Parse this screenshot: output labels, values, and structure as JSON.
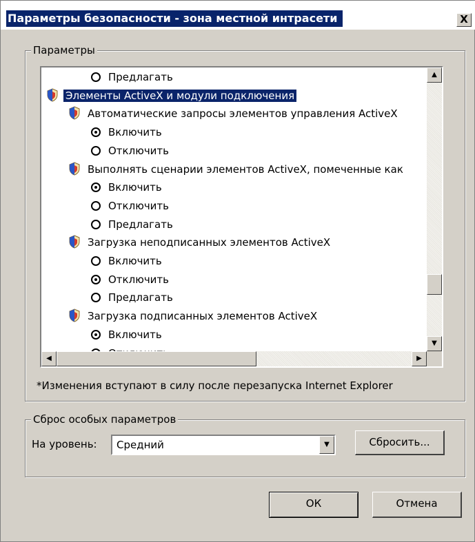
{
  "window": {
    "title": "Параметры безопасности - зона местной интрасети",
    "close_label": "X"
  },
  "params_group": {
    "label": "Параметры",
    "rows": [
      {
        "kind": "radio",
        "checked": false,
        "label": "Предлагать"
      },
      {
        "kind": "category",
        "selected": true,
        "label": "Элементы ActiveX и модули подключения"
      },
      {
        "kind": "setting",
        "label": "Автоматические запросы элементов управления ActiveX"
      },
      {
        "kind": "radio",
        "checked": true,
        "label": "Включить"
      },
      {
        "kind": "radio",
        "checked": false,
        "label": "Отключить"
      },
      {
        "kind": "setting",
        "label": "Выполнять сценарии элементов ActiveX, помеченные как"
      },
      {
        "kind": "radio",
        "checked": true,
        "label": "Включить"
      },
      {
        "kind": "radio",
        "checked": false,
        "label": "Отключить"
      },
      {
        "kind": "radio",
        "checked": false,
        "label": "Предлагать"
      },
      {
        "kind": "setting",
        "label": "Загрузка неподписанных элементов ActiveX"
      },
      {
        "kind": "radio",
        "checked": false,
        "label": "Включить"
      },
      {
        "kind": "radio",
        "checked": true,
        "label": "Отключить"
      },
      {
        "kind": "radio",
        "checked": false,
        "label": "Предлагать"
      },
      {
        "kind": "setting",
        "label": "Загрузка подписанных элементов ActiveX"
      },
      {
        "kind": "radio",
        "checked": true,
        "label": "Включить"
      },
      {
        "kind": "radio",
        "checked": false,
        "label": "Отключить"
      }
    ],
    "note": "*Изменения вступают в силу после перезапуска Internet Explorer"
  },
  "reset_group": {
    "label": "Сброс особых параметров",
    "level_label": "На уровень:",
    "level_value": "Средний",
    "reset_button": "Сбросить..."
  },
  "footer": {
    "ok_label": "ОК",
    "cancel_label": "Отмена"
  },
  "colors": {
    "selection": "#0a246a",
    "face": "#d4d0c8"
  }
}
